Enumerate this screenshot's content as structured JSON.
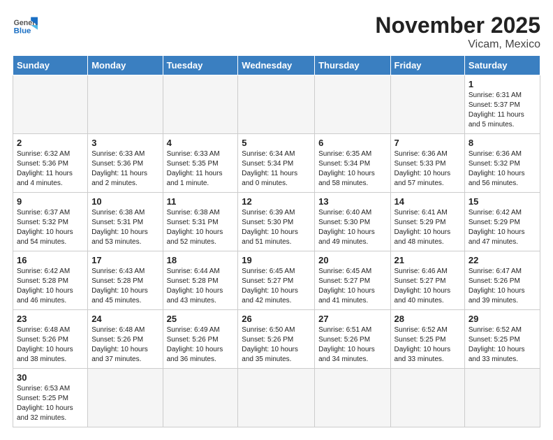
{
  "header": {
    "logo_general": "General",
    "logo_blue": "Blue",
    "title": "November 2025",
    "subtitle": "Vicam, Mexico"
  },
  "days_of_week": [
    "Sunday",
    "Monday",
    "Tuesday",
    "Wednesday",
    "Thursday",
    "Friday",
    "Saturday"
  ],
  "weeks": [
    [
      {
        "day": "",
        "info": ""
      },
      {
        "day": "",
        "info": ""
      },
      {
        "day": "",
        "info": ""
      },
      {
        "day": "",
        "info": ""
      },
      {
        "day": "",
        "info": ""
      },
      {
        "day": "",
        "info": ""
      },
      {
        "day": "1",
        "info": "Sunrise: 6:31 AM\nSunset: 5:37 PM\nDaylight: 11 hours and 5 minutes."
      }
    ],
    [
      {
        "day": "2",
        "info": "Sunrise: 6:32 AM\nSunset: 5:36 PM\nDaylight: 11 hours and 4 minutes."
      },
      {
        "day": "3",
        "info": "Sunrise: 6:33 AM\nSunset: 5:36 PM\nDaylight: 11 hours and 2 minutes."
      },
      {
        "day": "4",
        "info": "Sunrise: 6:33 AM\nSunset: 5:35 PM\nDaylight: 11 hours and 1 minute."
      },
      {
        "day": "5",
        "info": "Sunrise: 6:34 AM\nSunset: 5:34 PM\nDaylight: 11 hours and 0 minutes."
      },
      {
        "day": "6",
        "info": "Sunrise: 6:35 AM\nSunset: 5:34 PM\nDaylight: 10 hours and 58 minutes."
      },
      {
        "day": "7",
        "info": "Sunrise: 6:36 AM\nSunset: 5:33 PM\nDaylight: 10 hours and 57 minutes."
      },
      {
        "day": "8",
        "info": "Sunrise: 6:36 AM\nSunset: 5:32 PM\nDaylight: 10 hours and 56 minutes."
      }
    ],
    [
      {
        "day": "9",
        "info": "Sunrise: 6:37 AM\nSunset: 5:32 PM\nDaylight: 10 hours and 54 minutes."
      },
      {
        "day": "10",
        "info": "Sunrise: 6:38 AM\nSunset: 5:31 PM\nDaylight: 10 hours and 53 minutes."
      },
      {
        "day": "11",
        "info": "Sunrise: 6:38 AM\nSunset: 5:31 PM\nDaylight: 10 hours and 52 minutes."
      },
      {
        "day": "12",
        "info": "Sunrise: 6:39 AM\nSunset: 5:30 PM\nDaylight: 10 hours and 51 minutes."
      },
      {
        "day": "13",
        "info": "Sunrise: 6:40 AM\nSunset: 5:30 PM\nDaylight: 10 hours and 49 minutes."
      },
      {
        "day": "14",
        "info": "Sunrise: 6:41 AM\nSunset: 5:29 PM\nDaylight: 10 hours and 48 minutes."
      },
      {
        "day": "15",
        "info": "Sunrise: 6:42 AM\nSunset: 5:29 PM\nDaylight: 10 hours and 47 minutes."
      }
    ],
    [
      {
        "day": "16",
        "info": "Sunrise: 6:42 AM\nSunset: 5:28 PM\nDaylight: 10 hours and 46 minutes."
      },
      {
        "day": "17",
        "info": "Sunrise: 6:43 AM\nSunset: 5:28 PM\nDaylight: 10 hours and 45 minutes."
      },
      {
        "day": "18",
        "info": "Sunrise: 6:44 AM\nSunset: 5:28 PM\nDaylight: 10 hours and 43 minutes."
      },
      {
        "day": "19",
        "info": "Sunrise: 6:45 AM\nSunset: 5:27 PM\nDaylight: 10 hours and 42 minutes."
      },
      {
        "day": "20",
        "info": "Sunrise: 6:45 AM\nSunset: 5:27 PM\nDaylight: 10 hours and 41 minutes."
      },
      {
        "day": "21",
        "info": "Sunrise: 6:46 AM\nSunset: 5:27 PM\nDaylight: 10 hours and 40 minutes."
      },
      {
        "day": "22",
        "info": "Sunrise: 6:47 AM\nSunset: 5:26 PM\nDaylight: 10 hours and 39 minutes."
      }
    ],
    [
      {
        "day": "23",
        "info": "Sunrise: 6:48 AM\nSunset: 5:26 PM\nDaylight: 10 hours and 38 minutes."
      },
      {
        "day": "24",
        "info": "Sunrise: 6:48 AM\nSunset: 5:26 PM\nDaylight: 10 hours and 37 minutes."
      },
      {
        "day": "25",
        "info": "Sunrise: 6:49 AM\nSunset: 5:26 PM\nDaylight: 10 hours and 36 minutes."
      },
      {
        "day": "26",
        "info": "Sunrise: 6:50 AM\nSunset: 5:26 PM\nDaylight: 10 hours and 35 minutes."
      },
      {
        "day": "27",
        "info": "Sunrise: 6:51 AM\nSunset: 5:26 PM\nDaylight: 10 hours and 34 minutes."
      },
      {
        "day": "28",
        "info": "Sunrise: 6:52 AM\nSunset: 5:25 PM\nDaylight: 10 hours and 33 minutes."
      },
      {
        "day": "29",
        "info": "Sunrise: 6:52 AM\nSunset: 5:25 PM\nDaylight: 10 hours and 33 minutes."
      }
    ],
    [
      {
        "day": "30",
        "info": "Sunrise: 6:53 AM\nSunset: 5:25 PM\nDaylight: 10 hours and 32 minutes."
      },
      {
        "day": "",
        "info": ""
      },
      {
        "day": "",
        "info": ""
      },
      {
        "day": "",
        "info": ""
      },
      {
        "day": "",
        "info": ""
      },
      {
        "day": "",
        "info": ""
      },
      {
        "day": "",
        "info": ""
      }
    ]
  ]
}
